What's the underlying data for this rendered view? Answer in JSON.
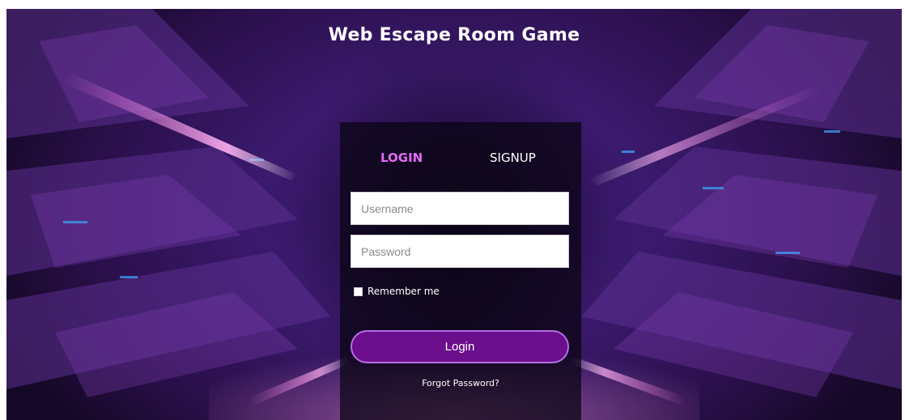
{
  "page": {
    "title": "Web Escape Room Game"
  },
  "tabs": [
    {
      "label": "LOGIN",
      "active": true,
      "color": "#e66bf2"
    },
    {
      "label": "SIGNUP",
      "active": false,
      "color": "#ffffff"
    }
  ],
  "form": {
    "username": {
      "value": "",
      "placeholder": "Username"
    },
    "password": {
      "value": "",
      "placeholder": "Password"
    },
    "remember_label": "Remember me",
    "remember_checked": false,
    "login_label": "Login",
    "forgot_label": "Forgot Password?"
  },
  "colors": {
    "accent": "#e66bf2",
    "button": "#6b0f8c",
    "button_border": "#b36fe3"
  }
}
